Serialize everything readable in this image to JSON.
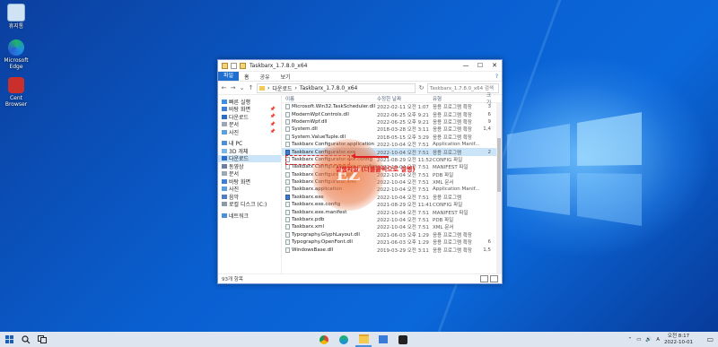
{
  "desktop": {
    "icons": [
      {
        "label": "휴지통"
      },
      {
        "label": "Microsoft Edge"
      },
      {
        "label": "Cent Browser"
      }
    ]
  },
  "explorer": {
    "title": "Taskbarx_1.7.8.0_x64",
    "window_controls": {
      "minimize": "—",
      "maximize": "☐",
      "close": "✕"
    },
    "ribbon": {
      "file": "파일",
      "home": "홈",
      "share": "공유",
      "view": "보기",
      "help": "?"
    },
    "address": {
      "part1": "다운로드",
      "part2": "Taskbarx_1.7.8.0_x64"
    },
    "search_placeholder": "Taskbarx_1.7.8.0_x64 검색",
    "nav": {
      "quick_access": "빠른 실행",
      "desktop": "바탕 화면",
      "downloads": "다운로드",
      "documents": "문서",
      "pictures": "사진",
      "this_pc": "내 PC",
      "objects3d": "3D 개체",
      "downloads2": "다운로드",
      "videos": "동영상",
      "documents2": "문서",
      "desktop2": "바탕 화면",
      "pictures2": "사진",
      "music": "음악",
      "local_disk": "로컬 디스크 (C:)",
      "network": "네트워크"
    },
    "columns": {
      "name": "이름",
      "date": "수정한 날짜",
      "type": "유형",
      "size": "크기"
    },
    "files": [
      {
        "name": "Microsoft.Win32.TaskScheduler.dll",
        "date": "2022-02-11 오전 1:07",
        "type": "응용 프로그램 확장",
        "size": "3"
      },
      {
        "name": "ModernWpf.Controls.dll",
        "date": "2022-06-25 오후 9:21",
        "type": "응용 프로그램 확장",
        "size": "6"
      },
      {
        "name": "ModernWpf.dll",
        "date": "2022-06-25 오후 9:21",
        "type": "응용 프로그램 확장",
        "size": "9"
      },
      {
        "name": "System.dll",
        "date": "2018-03-28 오전 3:11",
        "type": "응용 프로그램 확장",
        "size": "1,4"
      },
      {
        "name": "System.ValueTuple.dll",
        "date": "2018-05-15 오후 3:29",
        "type": "응용 프로그램 확장",
        "size": ""
      },
      {
        "name": "Taskbarx Configurator.application",
        "date": "2022-10-04 오전 7:51",
        "type": "Application Manif...",
        "size": ""
      },
      {
        "name": "Taskbarx Configurator.exe",
        "date": "2022-10-04 오전 7:51",
        "type": "응용 프로그램",
        "size": "2"
      },
      {
        "name": "Taskbarx Configurator.exe.config",
        "date": "2021-08-29 오전 11:52",
        "type": "CONFIG 파일",
        "size": ""
      },
      {
        "name": "Taskbarx Configurator.exe.manifest",
        "date": "2022-10-04 오전 7:51",
        "type": "MANIFEST 파일",
        "size": ""
      },
      {
        "name": "Taskbarx Configurator.pdb",
        "date": "2022-10-04 오전 7:51",
        "type": "PDB 파일",
        "size": ""
      },
      {
        "name": "Taskbarx Configurator.xml",
        "date": "2022-10-04 오전 7:51",
        "type": "XML 문서",
        "size": ""
      },
      {
        "name": "Taskbarx.application",
        "date": "2022-10-04 오전 7:51",
        "type": "Application Manif...",
        "size": ""
      },
      {
        "name": "Taskbarx.exe",
        "date": "2022-10-04 오전 7:51",
        "type": "응용 프로그램",
        "size": ""
      },
      {
        "name": "Taskbarx.exe.config",
        "date": "2021-08-29 오전 11:41",
        "type": "CONFIG 파일",
        "size": ""
      },
      {
        "name": "Taskbarx.exe.manifest",
        "date": "2022-10-04 오전 7:51",
        "type": "MANIFEST 파일",
        "size": ""
      },
      {
        "name": "Taskbarx.pdb",
        "date": "2022-10-04 오전 7:51",
        "type": "PDB 파일",
        "size": ""
      },
      {
        "name": "Taskbarx.xml",
        "date": "2022-10-04 오전 7:51",
        "type": "XML 문서",
        "size": ""
      },
      {
        "name": "Typography.GlyphLayout.dll",
        "date": "2021-06-03 오후 1:29",
        "type": "응용 프로그램 확장",
        "size": ""
      },
      {
        "name": "Typography.OpenFont.dll",
        "date": "2021-06-03 오후 1:29",
        "type": "응용 프로그램 확장",
        "size": "6"
      },
      {
        "name": "WindowsBase.dll",
        "date": "2019-03-29 오전 3:11",
        "type": "응용 프로그램 확장",
        "size": "1,5"
      }
    ],
    "status": "93개 항목",
    "highlight_caption": "실행파일 (더블클릭으로 실행)"
  },
  "taskbar": {
    "time": "오전 8:17",
    "date": "2022-10-01",
    "lang": "A",
    "notif": "▭"
  },
  "colors": {
    "accent": "#1e6fd0",
    "highlight": "#cce4f7",
    "annotation": "#e02020"
  }
}
